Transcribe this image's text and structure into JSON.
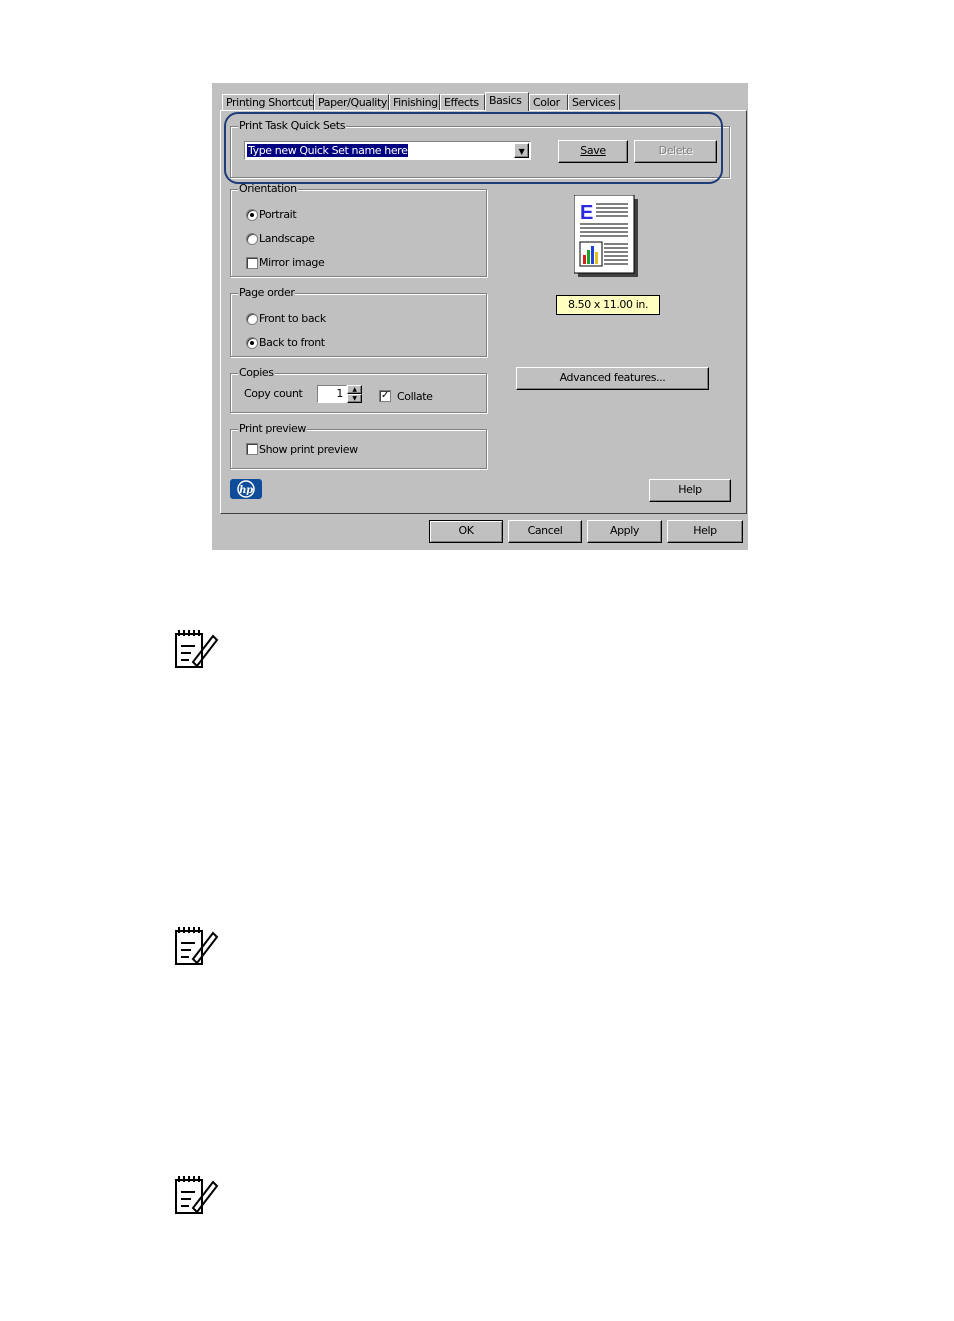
{
  "tabs": [
    "Printing Shortcuts",
    "Paper/Quality",
    "Finishing",
    "Effects",
    "Basics",
    "Color",
    "Services"
  ],
  "active_tab": "Basics",
  "quick_sets": {
    "legend": "Print Task Quick Sets",
    "value": "Type new Quick Set name here",
    "save_label": "Save",
    "delete_label": "Delete"
  },
  "orientation": {
    "legend": "Orientation",
    "portrait": "Portrait",
    "landscape": "Landscape",
    "mirror": "Mirror image"
  },
  "page_order": {
    "legend": "Page order",
    "front": "Front to back",
    "back": "Back to front"
  },
  "copies": {
    "legend": "Copies",
    "count_label": "Copy count",
    "count_value": "1",
    "collate": "Collate"
  },
  "print_preview": {
    "legend": "Print preview",
    "show": "Show print preview"
  },
  "paper_size": "8.50 x 11.00 in.",
  "advanced_label": "Advanced features...",
  "help_inner": "Help",
  "footer": {
    "ok": "OK",
    "cancel": "Cancel",
    "apply": "Apply",
    "help": "Help"
  },
  "colors": {
    "dialog_bg": "#c0c0c0",
    "selection": "#000080",
    "tooltip_bg": "#ffffc0",
    "highlight_oval": "#1f3b7a",
    "hp_logo": "#0f4d9a"
  }
}
